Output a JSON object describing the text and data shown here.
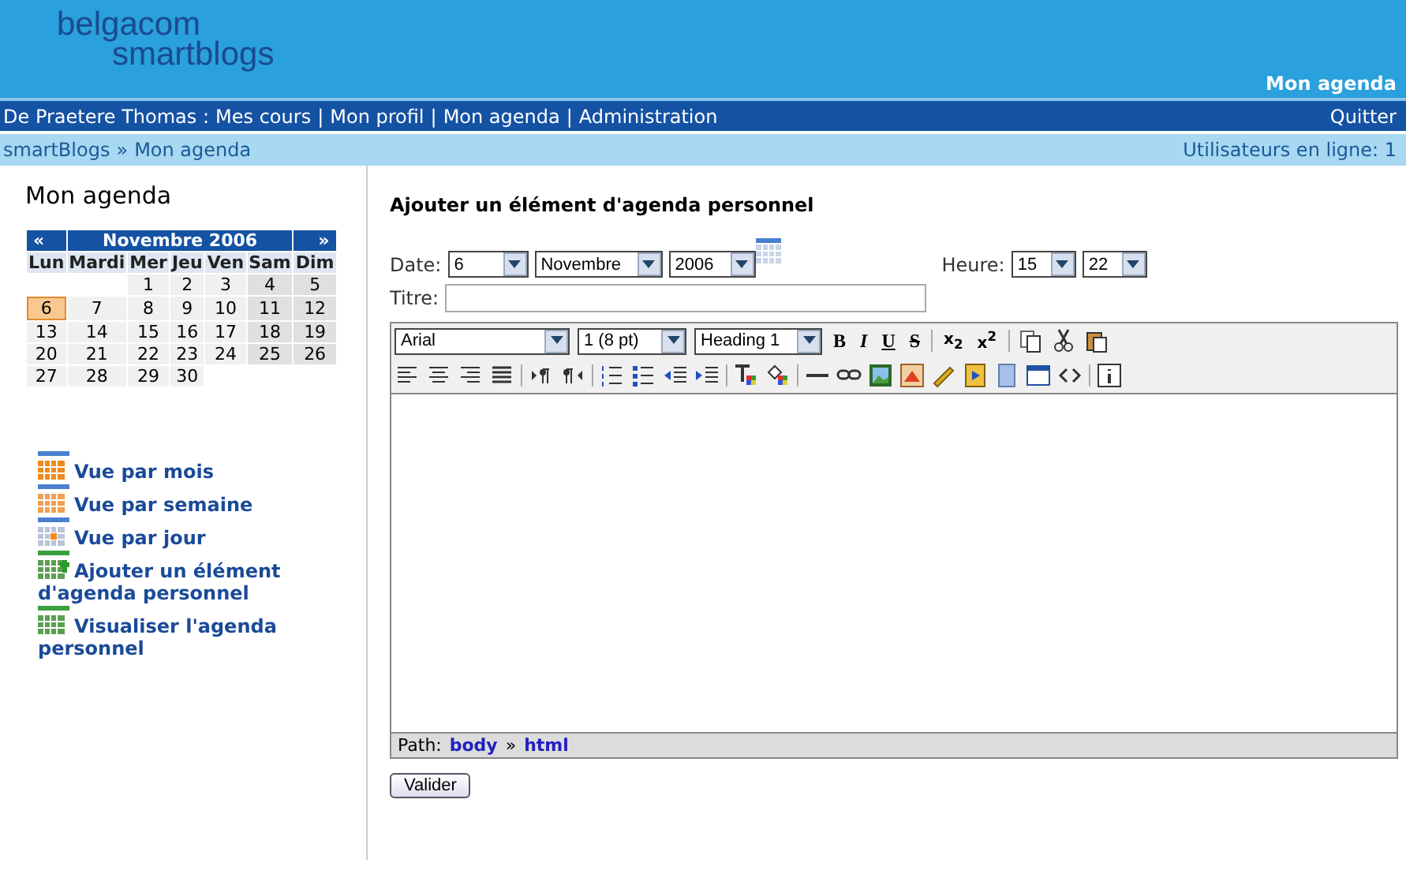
{
  "header": {
    "logo_top": "belgacom",
    "logo_bottom": "smartblogs",
    "page_title": "Mon agenda"
  },
  "nav": {
    "user": "De Praetere Thomas :",
    "separator": "|",
    "links": [
      "Mes cours",
      "Mon profil",
      "Mon agenda",
      "Administration"
    ],
    "logout": "Quitter"
  },
  "breadcrumb": {
    "separator": "»",
    "items": [
      "smartBlogs",
      "Mon agenda"
    ],
    "online": "Utilisateurs en ligne: 1"
  },
  "heading": "Mon agenda",
  "calendar": {
    "prev": "«",
    "title": "Novembre 2006",
    "next": "»",
    "days": [
      "Lun",
      "Mardi",
      "Mer",
      "Jeu",
      "Ven",
      "Sam",
      "Dim"
    ],
    "weeks": [
      {
        "kind": "first",
        "days": [
          {
            "day": "1",
            "selected": false
          },
          {
            "day": "2",
            "selected": false
          },
          {
            "day": "3",
            "selected": false
          },
          {
            "day": "4",
            "selected": false
          },
          {
            "day": "5",
            "selected": false
          }
        ]
      },
      {
        "kind": "full",
        "days": [
          {
            "day": "6",
            "selected": true
          },
          {
            "day": "7",
            "selected": false
          },
          {
            "day": "8",
            "selected": false
          },
          {
            "day": "9",
            "selected": false
          },
          {
            "day": "10",
            "selected": false
          },
          {
            "day": "11",
            "selected": false
          },
          {
            "day": "12",
            "selected": false
          }
        ]
      },
      {
        "kind": "full",
        "days": [
          {
            "day": "13",
            "selected": false
          },
          {
            "day": "14",
            "selected": false
          },
          {
            "day": "15",
            "selected": false
          },
          {
            "day": "16",
            "selected": false
          },
          {
            "day": "17",
            "selected": false
          },
          {
            "day": "18",
            "selected": false
          },
          {
            "day": "19",
            "selected": false
          }
        ]
      },
      {
        "kind": "full",
        "days": [
          {
            "day": "20",
            "selected": false
          },
          {
            "day": "21",
            "selected": false
          },
          {
            "day": "22",
            "selected": false
          },
          {
            "day": "23",
            "selected": false
          },
          {
            "day": "24",
            "selected": false
          },
          {
            "day": "25",
            "selected": false
          },
          {
            "day": "26",
            "selected": false
          }
        ]
      },
      {
        "kind": "last",
        "days": [
          {
            "day": "27",
            "selected": false
          },
          {
            "day": "28",
            "selected": false
          },
          {
            "day": "29",
            "selected": false
          },
          {
            "day": "30",
            "selected": false
          }
        ]
      }
    ]
  },
  "menu": [
    {
      "kind": "month",
      "label": "Vue par mois"
    },
    {
      "kind": "week",
      "label": "Vue par semaine"
    },
    {
      "kind": "day",
      "label": "Vue par jour"
    },
    {
      "kind": "add",
      "label": "Ajouter un élément d'agenda personnel"
    },
    {
      "kind": "view",
      "label": "Visualiser l'agenda personnel"
    }
  ],
  "form": {
    "title": "Ajouter un élément d'agenda personnel",
    "date_label": "Date:",
    "day": "6",
    "month": "Novembre",
    "year": "2006",
    "time_label": "Heure:",
    "hour": "15",
    "minute": "22",
    "title_label": "Titre:",
    "font": "Arial",
    "size": "1 (8 pt)",
    "format": "Heading 1",
    "text_buttons": [
      {
        "kind": "bold",
        "label": "B"
      },
      {
        "kind": "italic",
        "label": "I"
      },
      {
        "kind": "underline",
        "label": "U"
      },
      {
        "kind": "strike",
        "label": "S"
      },
      {
        "kind": "plain",
        "label": "x$_{2}$"
      },
      {
        "kind": "plain",
        "label": "x$^{2}$"
      }
    ],
    "path_label": "Path:",
    "path_separator": "»",
    "path": [
      "body",
      "html"
    ],
    "submit": "Valider"
  }
}
